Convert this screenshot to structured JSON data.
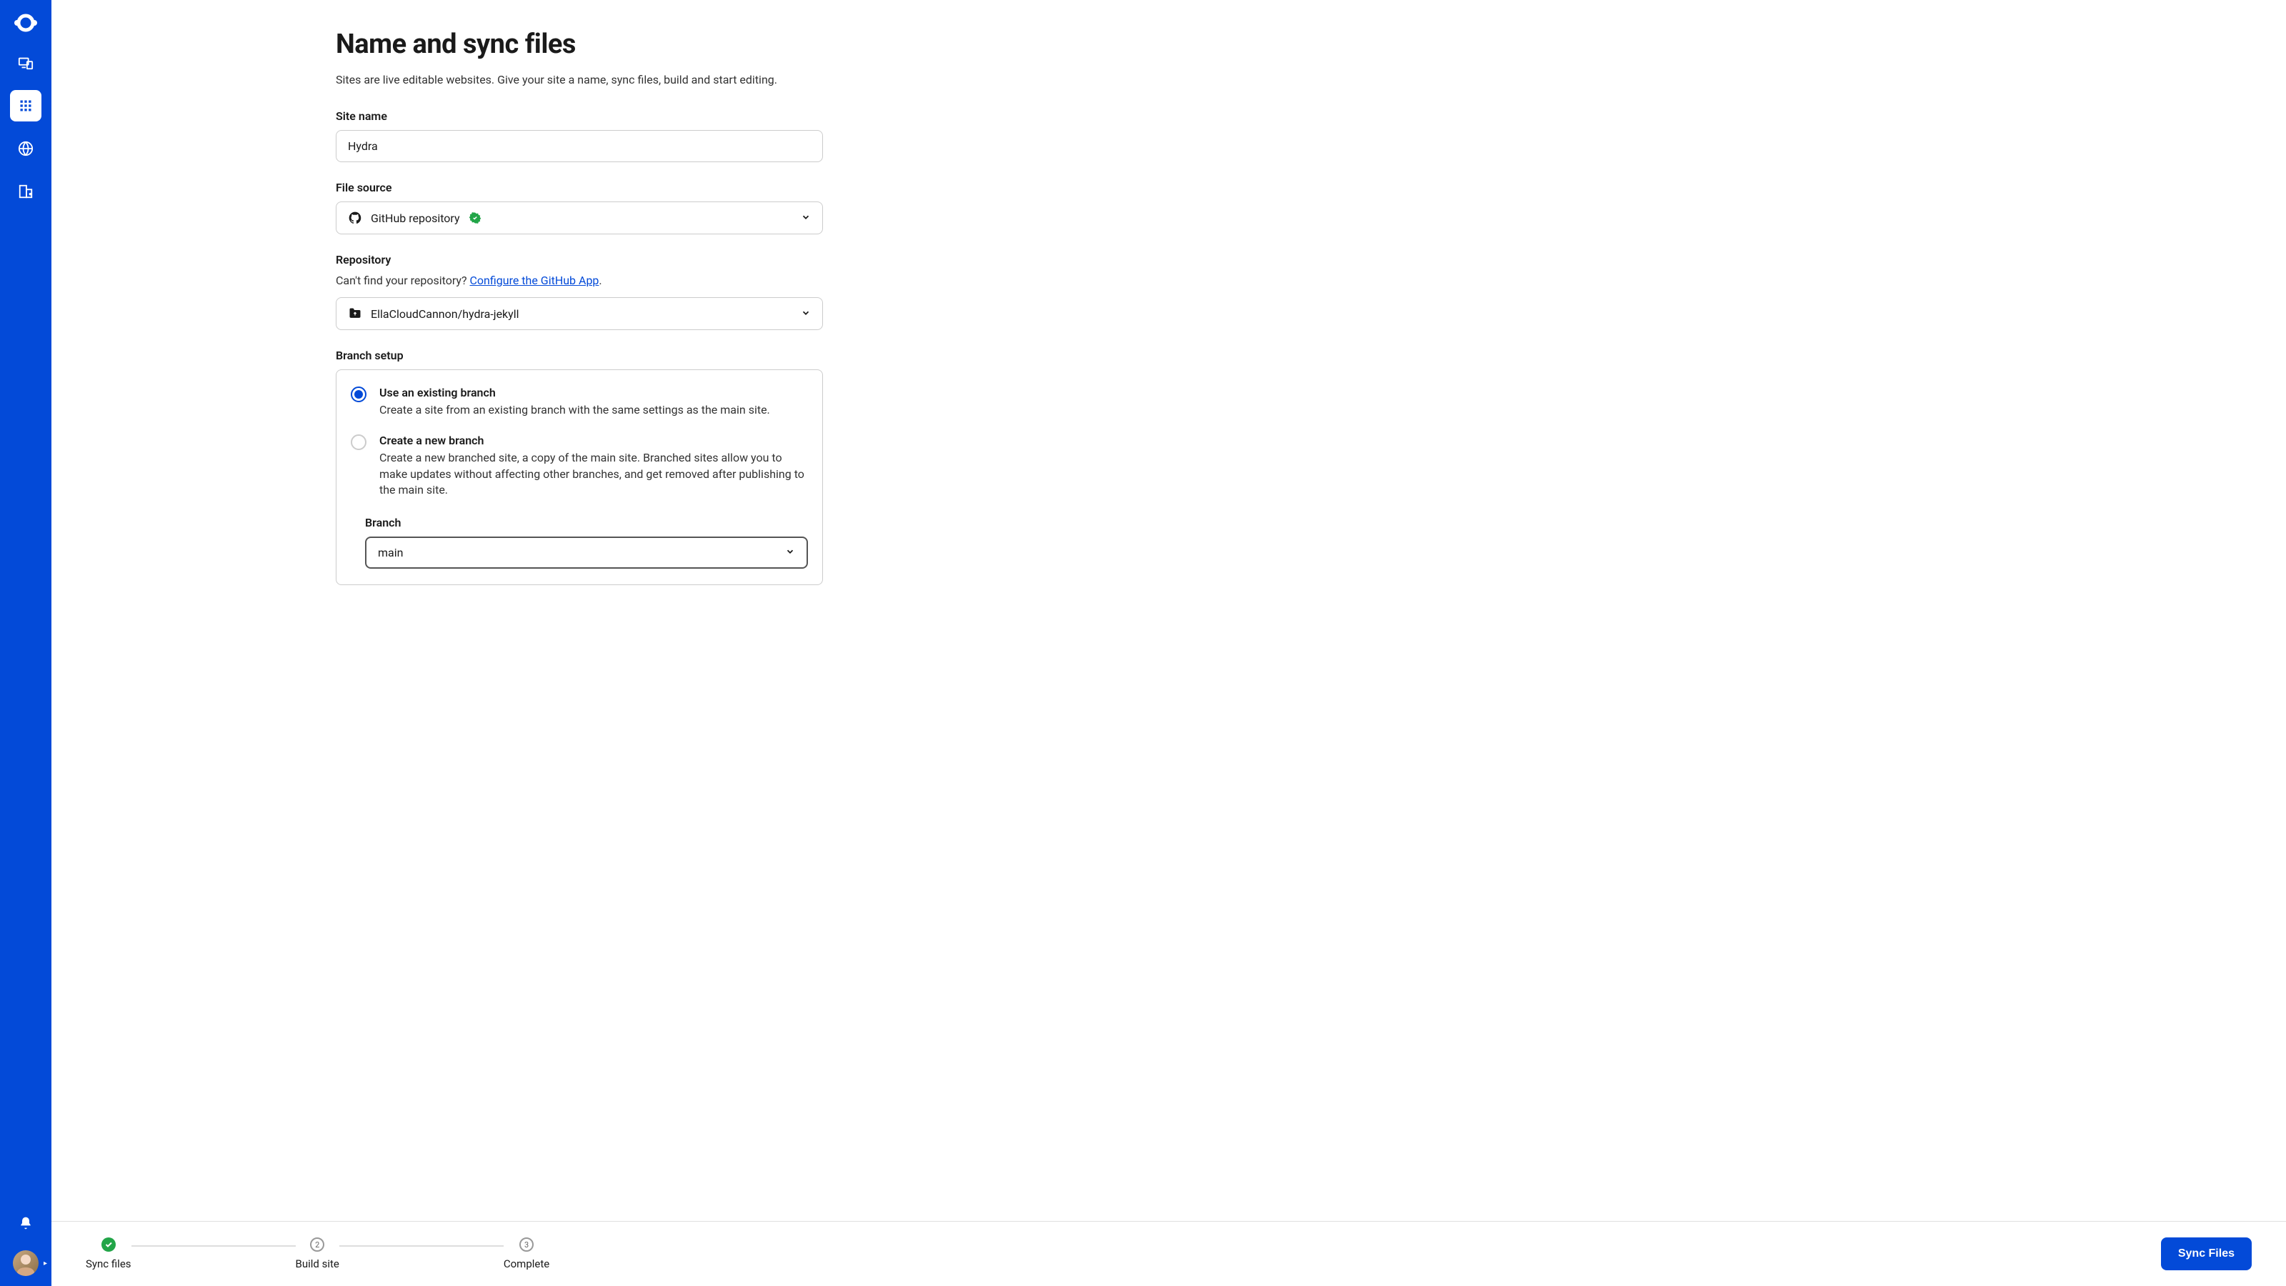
{
  "page": {
    "title": "Name and sync files",
    "subtitle": "Sites are live editable websites. Give your site a name, sync files, build and start editing."
  },
  "siteName": {
    "label": "Site name",
    "value": "Hydra"
  },
  "fileSource": {
    "label": "File source",
    "selected": "GitHub repository"
  },
  "repository": {
    "label": "Repository",
    "helpPrefix": "Can't find your repository? ",
    "helpLink": "Configure the GitHub App",
    "helpSuffix": ".",
    "selected": "EllaCloudCannon/hydra-jekyll"
  },
  "branchSetup": {
    "label": "Branch setup",
    "options": [
      {
        "title": "Use an existing branch",
        "description": "Create a site from an existing branch with the same settings as the main site.",
        "selected": true
      },
      {
        "title": "Create a new branch",
        "description": "Create a new branched site, a copy of the main site. Branched sites allow you to make updates without affecting other branches, and get removed after publishing to the main site.",
        "selected": false
      }
    ],
    "branchLabel": "Branch",
    "branchValue": "main"
  },
  "steps": [
    {
      "label": "Sync files",
      "status": "done"
    },
    {
      "label": "Build site",
      "status": "pending",
      "num": "2"
    },
    {
      "label": "Complete",
      "status": "pending",
      "num": "3"
    }
  ],
  "actions": {
    "primary": "Sync Files"
  }
}
